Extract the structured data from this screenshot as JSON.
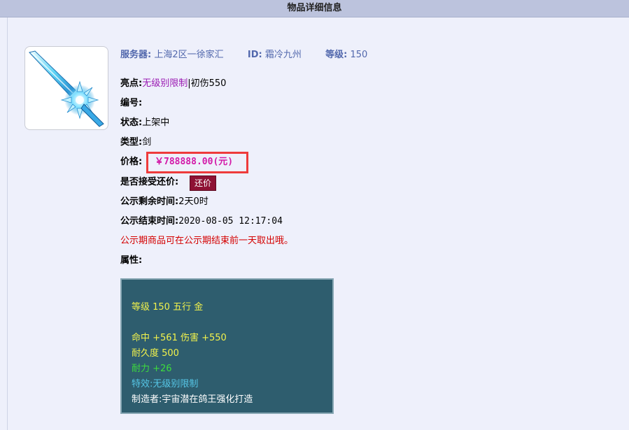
{
  "header": {
    "title": "物品详细信息"
  },
  "item": {
    "server_label": "服务器:",
    "server_value": "上海2区一徐家汇",
    "id_label": "ID:",
    "id_value": "霜冷九州",
    "level_label": "等级:",
    "level_value": "150",
    "highlight_label": "亮点:",
    "highlight_purple": "无级别限制",
    "highlight_rest": "|初伤550",
    "number_label": "编号:",
    "status_label": "状态:",
    "status_value": "上架中",
    "type_label": "类型:",
    "type_value": "剑",
    "price_label": "价格:",
    "price_value": "￥788888.00(元)",
    "haggle_label": "是否接受还价:",
    "haggle_button": "还价",
    "remaining_label": "公示剩余时间:",
    "remaining_value": "2天0时",
    "end_label": "公示结束时间:",
    "end_value": "2020-08-05 12:17:04",
    "notice": "公示期商品可在公示期结束前一天取出哦。",
    "attr_label": "属性:"
  },
  "attributes": {
    "line1": "等级 150 五行 金",
    "line2": "命中 +561 伤害 +550",
    "line3": "耐久度 500",
    "line4": "耐力 +26",
    "line5": "特效:无级别限制",
    "line6": "制造者:宇宙潜在鸽王强化打造"
  },
  "colors": {
    "accent_blue": "#5268ad",
    "price_pink": "#d319a8",
    "notice_red": "#d40000",
    "button_maroon": "#8e1234",
    "attr_panel_bg": "#2e5d6e"
  },
  "icons": {
    "item_image": "ice-sword-icon"
  }
}
